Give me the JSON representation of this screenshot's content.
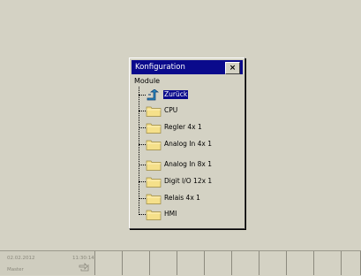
{
  "dialog": {
    "title": "Konfiguration",
    "close_label": "×",
    "tree": {
      "root_label": "Module",
      "items": [
        {
          "label": "Zurück",
          "icon": "back-arrow-icon",
          "selected": true
        },
        {
          "label": "CPU",
          "icon": "folder-icon",
          "selected": false
        },
        {
          "label": "Regler 4x 1",
          "icon": "folder-icon",
          "selected": false
        },
        {
          "label": "Analog In 4x 1",
          "icon": "folder-icon",
          "selected": false
        },
        {
          "label": "Analog In 8x 1",
          "icon": "folder-icon",
          "selected": false
        },
        {
          "label": "Digit I/O 12x 1",
          "icon": "folder-icon",
          "selected": false
        },
        {
          "label": "Relais 4x 1",
          "icon": "folder-icon",
          "selected": false
        },
        {
          "label": "HMI",
          "icon": "folder-icon",
          "selected": false
        }
      ]
    }
  },
  "statusbar": {
    "date": "02.02.2012",
    "time": "11:30:14",
    "user": "Master",
    "user_icon": "login-arrow-icon"
  },
  "colors": {
    "background": "#d4d2c4",
    "titlebar": "#0a0a8c",
    "selection": "#0a0a8c",
    "folder": "#f5e08a"
  }
}
